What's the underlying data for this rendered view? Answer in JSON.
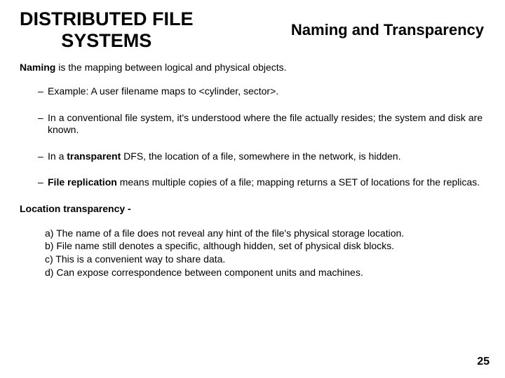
{
  "header": {
    "title_left": "DISTRIBUTED FILE\nSYSTEMS",
    "title_right": "Naming and Transparency"
  },
  "intro": {
    "label": "Naming",
    "rest": " is the mapping between logical and physical objects."
  },
  "bullets": {
    "b1": "Example: A user filename maps to  <cylinder, sector>.",
    "b2": "In a conventional file system, it's understood where the file actually resides; the system and disk are known.",
    "b3_pre": "In a ",
    "b3_bold": "transparent",
    "b3_post": " DFS, the location of a file, somewhere in the network, is hidden.",
    "b4_bold": "File replication",
    "b4_post": " means multiple copies of a file; mapping returns a SET of locations for the replicas."
  },
  "section_head": "Location  transparency -",
  "alpha": {
    "a": "a) The name of a file does not reveal any hint of the file's physical storage location.",
    "b": "b) File name still denotes a specific, although hidden, set of physical disk blocks.",
    "c": "c) This is a convenient way to share data.",
    "d": "d) Can expose correspondence between component units and machines."
  },
  "page_number": "25"
}
